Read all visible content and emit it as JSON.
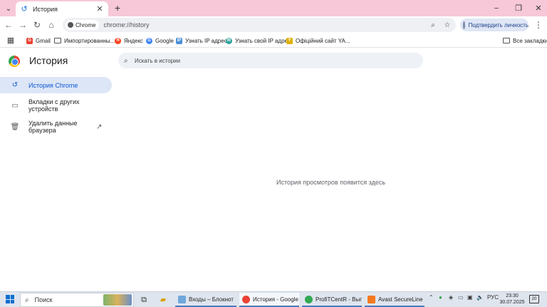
{
  "tab": {
    "title": "История",
    "close": "✕",
    "new_tab": "+"
  },
  "window_controls": {
    "minimize": "−",
    "maximize": "❐",
    "close": "✕"
  },
  "toolbar": {
    "chip_label": "Chrome",
    "url": "chrome://history",
    "profile_label": "Подтвердить личность"
  },
  "bookmarks": [
    {
      "label": "Gmail",
      "color": "#ea4335",
      "glyph": "G"
    },
    {
      "label": "Импортированны...",
      "folder": true
    },
    {
      "label": "Яндекс",
      "color": "#fc3f1d",
      "glyph": "Я"
    },
    {
      "label": "Google",
      "color": "#4285f4",
      "glyph": "G"
    },
    {
      "label": "Узнать IP адрес",
      "color": "#4a90d9",
      "glyph": "IP"
    },
    {
      "label": "Узнать свой IP адрес",
      "color": "#2aa198",
      "glyph": "W"
    },
    {
      "label": "Офіційний сайт YA...",
      "color": "#e0b000",
      "glyph": "Y"
    }
  ],
  "all_bookmarks": "Все закладки",
  "page": {
    "title": "История",
    "search_placeholder": "Искать в истории",
    "sidebar": [
      {
        "label": "История Chrome",
        "active": true
      },
      {
        "label": "Вкладки с других устройств",
        "active": false
      },
      {
        "label": "Удалить данные браузера",
        "active": false
      }
    ],
    "empty_message": "История просмотров появится здесь"
  },
  "taskbar": {
    "search_label": "Поиск",
    "apps": [
      {
        "label": "Входы – Блокнот",
        "color": "#6ea8dc"
      },
      {
        "label": "История - Google ...",
        "color": "#ea4335",
        "active": true
      },
      {
        "label": "ProfiTCentR - Вып...",
        "color": "#34a853"
      },
      {
        "label": "Avast SecureLine V...",
        "color": "#f47a20"
      }
    ],
    "language": "РУС",
    "time": "23:30",
    "date": "30.07.2025",
    "notifications": "20"
  }
}
